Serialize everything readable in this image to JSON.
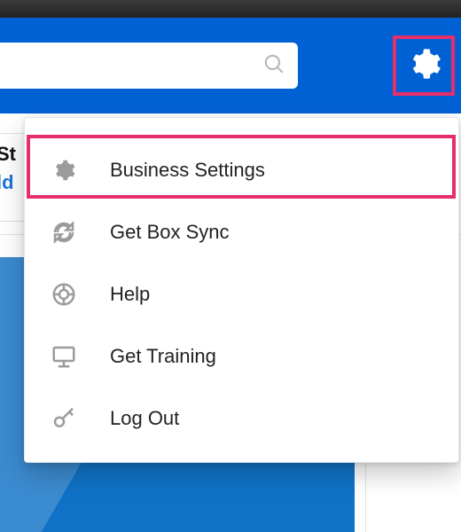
{
  "colors": {
    "brand_blue": "#0061d5",
    "highlight_pink": "#e62e6b",
    "icon_grey": "#9b9b9b"
  },
  "search": {
    "placeholder": ""
  },
  "left_panel": {
    "line1": "St",
    "line2": "ld"
  },
  "menu": {
    "items": [
      {
        "id": "business-settings",
        "icon": "gear-icon",
        "label": "Business Settings"
      },
      {
        "id": "get-box-sync",
        "icon": "sync-icon",
        "label": "Get Box Sync"
      },
      {
        "id": "help",
        "icon": "lifebuoy-icon",
        "label": "Help"
      },
      {
        "id": "get-training",
        "icon": "training-icon",
        "label": "Get Training"
      },
      {
        "id": "log-out",
        "icon": "key-icon",
        "label": "Log Out"
      }
    ]
  }
}
